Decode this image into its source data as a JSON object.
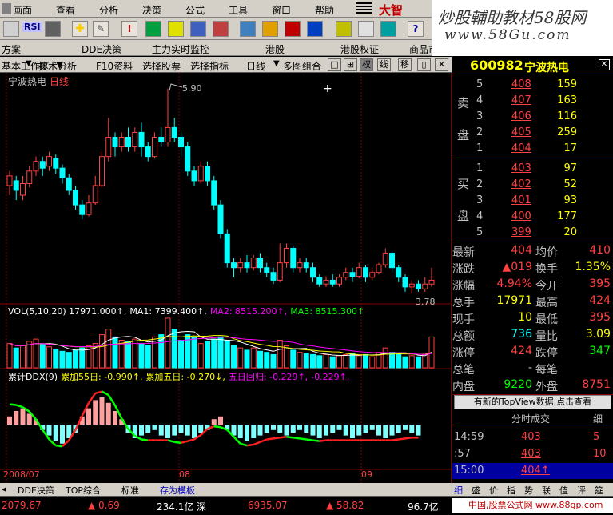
{
  "menu": [
    "画面",
    "查看",
    "分析",
    "决策",
    "公式",
    "工具",
    "窗口",
    "帮助"
  ],
  "brand": "大智",
  "toolbar": {
    "btn1": "RSI"
  },
  "watermark": {
    "line1": "炒股輔助教材58股网",
    "line2": "www.58Gu.com"
  },
  "nav": [
    "DDE决策",
    "主力实时监控",
    "港股",
    "港股权证",
    "商品市场",
    "固定收益平台"
  ],
  "nav_left": "方案",
  "workspace": "基本工作区",
  "bar2": [
    "技术分析",
    "F10资料",
    "选择股票",
    "选择指标",
    "日线",
    "多图组合"
  ],
  "bar2_btns": [
    "权",
    "线",
    "移"
  ],
  "chart": {
    "title": "宁波热电",
    "period": "日线",
    "high_label": "5.90",
    "low_label": "3.78",
    "vol_line": "VOL(5,10,20) 17971.000↑, MA1: 7399.400↑, MA2: 8515.200↑, MA3: 8515.300↑",
    "vol_parts": [
      {
        "t": "VOL(5,10,20) 17971.000↑,",
        "c": "#fff"
      },
      {
        "t": "MA1: 7399.400↑,",
        "c": "#fff"
      },
      {
        "t": "MA2: 8515.200↑,",
        "c": "#ff00ff"
      },
      {
        "t": "MA3: 8515.300↑",
        "c": "#00ff00"
      }
    ],
    "ddx_parts": [
      {
        "t": "累计DDX(9)",
        "c": "#fff"
      },
      {
        "t": "累加55日: -0.990↑,",
        "c": "#ffff00"
      },
      {
        "t": "累加五日: -0.270↓,",
        "c": "#ffff00"
      },
      {
        "t": "五日回归: -0.229↑,",
        "c": "#ff00ff"
      },
      {
        "t": "-0.229↑,",
        "c": "#ff00ff"
      }
    ],
    "date_labels": [
      "2008/07",
      "08",
      "09"
    ],
    "candles": [
      {
        "o": 4.9,
        "c": 5.0,
        "h": 5.05,
        "l": 4.8
      },
      {
        "o": 4.95,
        "c": 4.85,
        "h": 5.0,
        "l": 4.75
      },
      {
        "o": 4.8,
        "c": 4.92,
        "h": 5.0,
        "l": 4.75
      },
      {
        "o": 4.92,
        "c": 5.05,
        "h": 5.1,
        "l": 4.88
      },
      {
        "o": 5.05,
        "c": 5.15,
        "h": 5.2,
        "l": 5.0
      },
      {
        "o": 5.15,
        "c": 5.08,
        "h": 5.2,
        "l": 5.0
      },
      {
        "o": 5.1,
        "c": 5.2,
        "h": 5.25,
        "l": 5.05
      },
      {
        "o": 5.18,
        "c": 5.08,
        "h": 5.22,
        "l": 5.02
      },
      {
        "o": 5.08,
        "c": 4.98,
        "h": 5.12,
        "l": 4.92
      },
      {
        "o": 4.98,
        "c": 4.85,
        "h": 5.02,
        "l": 4.8
      },
      {
        "o": 4.85,
        "c": 4.7,
        "h": 4.9,
        "l": 4.65
      },
      {
        "o": 4.7,
        "c": 4.6,
        "h": 4.75,
        "l": 4.55
      },
      {
        "o": 4.6,
        "c": 4.72,
        "h": 4.8,
        "l": 4.58
      },
      {
        "o": 4.72,
        "c": 4.9,
        "h": 5.0,
        "l": 4.7
      },
      {
        "o": 4.9,
        "c": 5.2,
        "h": 5.25,
        "l": 4.88
      },
      {
        "o": 5.2,
        "c": 5.4,
        "h": 5.6,
        "l": 5.15
      },
      {
        "o": 5.4,
        "c": 5.3,
        "h": 5.45,
        "l": 5.2
      },
      {
        "o": 5.3,
        "c": 5.4,
        "h": 5.45,
        "l": 5.25
      },
      {
        "o": 5.4,
        "c": 5.3,
        "h": 5.5,
        "l": 5.25
      },
      {
        "o": 5.3,
        "c": 5.45,
        "h": 5.5,
        "l": 5.25
      },
      {
        "o": 5.45,
        "c": 5.3,
        "h": 5.55,
        "l": 5.2
      },
      {
        "o": 5.3,
        "c": 5.2,
        "h": 5.35,
        "l": 5.15
      },
      {
        "o": 5.2,
        "c": 5.4,
        "h": 5.45,
        "l": 5.18
      },
      {
        "o": 5.4,
        "c": 5.35,
        "h": 5.5,
        "l": 5.3
      },
      {
        "o": 5.35,
        "c": 5.5,
        "h": 5.9,
        "l": 5.3
      },
      {
        "o": 5.5,
        "c": 5.4,
        "h": 5.6,
        "l": 5.35
      },
      {
        "o": 5.4,
        "c": 5.3,
        "h": 5.45,
        "l": 5.2
      },
      {
        "o": 5.3,
        "c": 5.05,
        "h": 5.35,
        "l": 5.0
      },
      {
        "o": 5.05,
        "c": 4.95,
        "h": 5.1,
        "l": 4.9
      },
      {
        "o": 4.95,
        "c": 5.1,
        "h": 5.15,
        "l": 4.92
      },
      {
        "o": 5.1,
        "c": 4.95,
        "h": 5.15,
        "l": 4.9
      },
      {
        "o": 4.95,
        "c": 4.7,
        "h": 5.0,
        "l": 4.65
      },
      {
        "o": 4.7,
        "c": 4.4,
        "h": 4.75,
        "l": 4.35
      },
      {
        "o": 4.4,
        "c": 4.1,
        "h": 4.45,
        "l": 4.05
      },
      {
        "o": 4.1,
        "c": 4.05,
        "h": 4.15,
        "l": 3.95
      },
      {
        "o": 4.05,
        "c": 4.1,
        "h": 4.15,
        "l": 4.0
      },
      {
        "o": 4.1,
        "c": 4.05,
        "h": 4.18,
        "l": 4.0
      },
      {
        "o": 4.05,
        "c": 4.15,
        "h": 4.18,
        "l": 4.02
      },
      {
        "o": 4.15,
        "c": 4.05,
        "h": 4.2,
        "l": 4.0
      },
      {
        "o": 4.05,
        "c": 4.0,
        "h": 4.1,
        "l": 3.95
      },
      {
        "o": 4.0,
        "c": 3.92,
        "h": 4.05,
        "l": 3.88
      },
      {
        "o": 3.92,
        "c": 4.1,
        "h": 4.3,
        "l": 3.9
      },
      {
        "o": 4.1,
        "c": 4.25,
        "h": 4.3,
        "l": 4.05
      },
      {
        "o": 4.25,
        "c": 4.05,
        "h": 4.28,
        "l": 4.0
      },
      {
        "o": 4.05,
        "c": 4.1,
        "h": 4.15,
        "l": 4.0
      },
      {
        "o": 4.1,
        "c": 4.05,
        "h": 4.15,
        "l": 4.0
      },
      {
        "o": 4.05,
        "c": 3.95,
        "h": 4.1,
        "l": 3.9
      },
      {
        "o": 3.95,
        "c": 3.88,
        "h": 3.98,
        "l": 3.85
      },
      {
        "o": 3.88,
        "c": 3.92,
        "h": 3.96,
        "l": 3.85
      },
      {
        "o": 3.92,
        "c": 3.88,
        "h": 3.98,
        "l": 3.85
      },
      {
        "o": 3.88,
        "c": 3.95,
        "h": 3.98,
        "l": 3.85
      },
      {
        "o": 3.95,
        "c": 4.0,
        "h": 4.05,
        "l": 3.92
      },
      {
        "o": 4.0,
        "c": 3.96,
        "h": 4.05,
        "l": 3.9
      },
      {
        "o": 3.96,
        "c": 4.05,
        "h": 4.1,
        "l": 3.94
      },
      {
        "o": 4.05,
        "c": 3.95,
        "h": 4.08,
        "l": 3.9
      },
      {
        "o": 3.95,
        "c": 4.0,
        "h": 4.05,
        "l": 3.92
      },
      {
        "o": 4.0,
        "c": 4.08,
        "h": 4.1,
        "l": 3.98
      },
      {
        "o": 4.08,
        "c": 4.2,
        "h": 4.25,
        "l": 4.05
      },
      {
        "o": 4.2,
        "c": 4.05,
        "h": 4.22,
        "l": 4.0
      },
      {
        "o": 4.05,
        "c": 3.95,
        "h": 4.08,
        "l": 3.9
      },
      {
        "o": 3.95,
        "c": 3.85,
        "h": 3.98,
        "l": 3.8
      },
      {
        "o": 3.85,
        "c": 3.88,
        "h": 3.92,
        "l": 3.78
      },
      {
        "o": 3.88,
        "c": 3.83,
        "h": 3.92,
        "l": 3.8
      },
      {
        "o": 3.83,
        "c": 3.88,
        "h": 3.95,
        "l": 3.8
      },
      {
        "o": 3.88,
        "c": 3.92,
        "h": 4.05,
        "l": 3.85
      }
    ],
    "volumes": [
      22,
      18,
      20,
      24,
      26,
      21,
      19,
      17,
      15,
      14,
      16,
      18,
      20,
      22,
      30,
      35,
      28,
      25,
      24,
      26,
      22,
      20,
      28,
      30,
      45,
      35,
      25,
      30,
      28,
      22,
      24,
      26,
      28,
      25,
      20,
      18,
      16,
      18,
      15,
      14,
      12,
      25,
      20,
      16,
      14,
      13,
      12,
      11,
      12,
      10,
      11,
      12,
      13,
      11,
      12,
      10,
      14,
      18,
      14,
      12,
      10,
      11,
      10,
      12,
      28
    ],
    "ddx": [
      0.3,
      0.5,
      0.6,
      0.4,
      0.2,
      -0.2,
      -0.4,
      -0.6,
      -0.7,
      -0.5,
      -0.3,
      0.3,
      0.6,
      0.9,
      1.0,
      0.8,
      0.5,
      0.2,
      -0.3,
      -0.5,
      -0.4,
      -0.3,
      -0.2,
      -0.4,
      -0.5,
      -0.4,
      -0.3,
      -0.4,
      -0.5,
      -0.3,
      -0.2,
      0.2,
      0.3,
      -0.2,
      -0.4,
      -0.5,
      -0.6,
      -0.5,
      -0.4,
      -0.3,
      -0.2,
      -0.3,
      -0.4,
      -0.3,
      -0.2,
      -0.3,
      -0.4,
      -0.5,
      -0.4,
      -0.3,
      -0.2,
      -0.4,
      -0.5,
      -0.4,
      -0.3,
      -0.2,
      -0.4,
      -0.5,
      -0.4,
      -0.3,
      -0.2,
      -0.3,
      -0.4
    ]
  },
  "quote": {
    "code": "600982",
    "name": "宁波热电",
    "sell_label": [
      "卖",
      "盘"
    ],
    "buy_label": [
      "买",
      "盘"
    ],
    "sell": [
      {
        "lvl": "5",
        "price": "408",
        "vol": "159"
      },
      {
        "lvl": "4",
        "price": "407",
        "vol": "163"
      },
      {
        "lvl": "3",
        "price": "406",
        "vol": "116"
      },
      {
        "lvl": "2",
        "price": "405",
        "vol": "259"
      },
      {
        "lvl": "1",
        "price": "404",
        "vol": "17"
      }
    ],
    "buy": [
      {
        "lvl": "1",
        "price": "403",
        "vol": "97"
      },
      {
        "lvl": "2",
        "price": "402",
        "vol": "52"
      },
      {
        "lvl": "3",
        "price": "401",
        "vol": "93"
      },
      {
        "lvl": "4",
        "price": "400",
        "vol": "177"
      },
      {
        "lvl": "5",
        "price": "399",
        "vol": "20"
      }
    ],
    "stats": [
      {
        "k1": "最新",
        "v1": "404",
        "c1": "#ff4040",
        "k2": "均价",
        "v2": "410",
        "c2": "#ff4040"
      },
      {
        "k1": "涨跌",
        "v1": "▲019",
        "c1": "#ff4040",
        "k2": "换手",
        "v2": "1.35%",
        "c2": "#ffff00"
      },
      {
        "k1": "涨幅",
        "v1": "4.94%",
        "c1": "#ff4040",
        "k2": "今开",
        "v2": "395",
        "c2": "#ff4040"
      },
      {
        "k1": "总手",
        "v1": "17971",
        "c1": "#ffff00",
        "k2": "最高",
        "v2": "424",
        "c2": "#ff4040"
      },
      {
        "k1": "现手",
        "v1": "10",
        "c1": "#ffff00",
        "k2": "最低",
        "v2": "395",
        "c2": "#ff4040"
      },
      {
        "k1": "总额",
        "v1": "736",
        "c1": "#00ffff",
        "k2": "量比",
        "v2": "3.09",
        "c2": "#ffff00"
      },
      {
        "k1": "涨停",
        "v1": "424",
        "c1": "#ff4040",
        "k2": "跌停",
        "v2": "347",
        "c2": "#00ff00"
      },
      {
        "k1": "总笔",
        "v1": "-",
        "c1": "#c0c0c0",
        "k2": "每笔",
        "v2": "",
        "c2": "#c0c0c0"
      },
      {
        "k1": "内盘",
        "v1": "9220",
        "c1": "#00ff00",
        "k2": "外盘",
        "v2": "8751",
        "c2": "#ff4040"
      }
    ],
    "topview": "有新的TopView数据,点击查看",
    "tick_header": "分时成交",
    "tick_tab": "细",
    "ticks": [
      {
        "time": "14:59",
        "price": "403",
        "vol": "5",
        "hl": false
      },
      {
        "time": ":57",
        "price": "403",
        "vol": "10",
        "hl": false
      },
      {
        "time": "15:00",
        "price": "404↑",
        "vol": "",
        "hl": true
      }
    ]
  },
  "bottom_tabs": [
    "DDE决策",
    "TOP综合",
    "标准",
    "存为模板"
  ],
  "right_tabs": [
    "细",
    "盛",
    "价",
    "指",
    "势",
    "联",
    "值",
    "评",
    "筵"
  ],
  "status": {
    "sh": "2079.67",
    "sh_chg": "▲ 0.69",
    "sh_amt": "234.1亿",
    "sz_label": "深",
    "sz": "6935.07",
    "sz_chg": "▲ 58.82",
    "sz_amt": "96.7亿",
    "right": "中国,股票公式网 www.88gp.com"
  }
}
